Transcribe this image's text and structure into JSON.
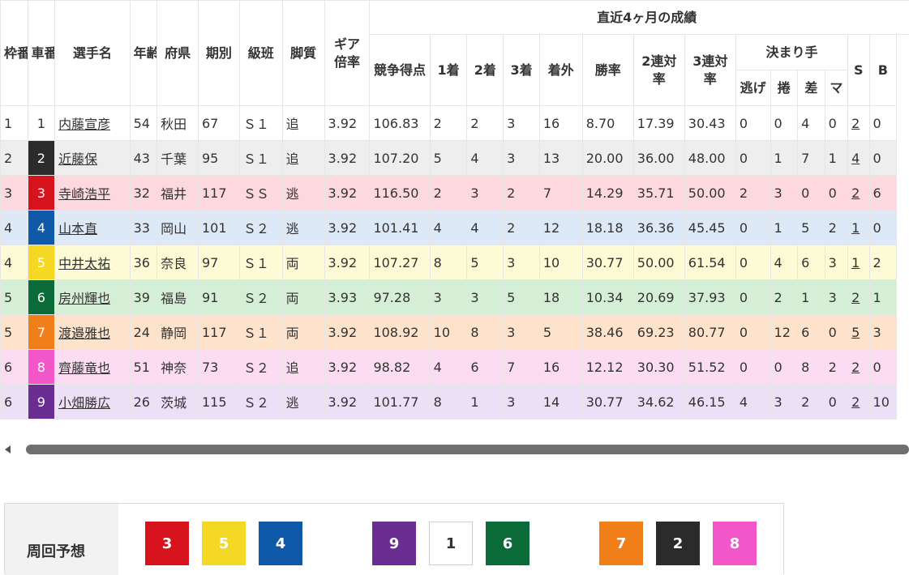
{
  "headers": {
    "waku": "枠番",
    "car": "車番",
    "name": "選手名",
    "age": "年齢",
    "pref": "府県",
    "term": "期別",
    "class": "級班",
    "leg": "脚質",
    "gear": "ギア倍率",
    "recent": "直近4ヶ月の成績",
    "score": "競争得点",
    "first": "1着",
    "second": "2着",
    "third": "3着",
    "outside": "着外",
    "win": "勝率",
    "rate2": "2連対率",
    "rate3": "3連対率",
    "kimarite": "決まり手",
    "nige": "逃げ",
    "makuri": "捲",
    "sashi": "差",
    "mark": "マ",
    "s": "S",
    "b": "B"
  },
  "rows": [
    {
      "waku": "1",
      "car": "1",
      "name": "内藤宣彦",
      "age": "54",
      "pref": "秋田",
      "term": "67",
      "class": "Ｓ１",
      "leg": "追",
      "gear": "3.92",
      "score": "106.83",
      "first": "2",
      "second": "2",
      "third": "3",
      "outside": "16",
      "win": "8.70",
      "rate2": "17.39",
      "rate3": "30.43",
      "nige": "0",
      "makuri": "0",
      "sashi": "4",
      "mark": "0",
      "s": "2",
      "b": "0",
      "bg": "#ffffff",
      "carColor": "#ffffff",
      "carText": "#333333"
    },
    {
      "waku": "2",
      "car": "2",
      "name": "近藤保",
      "age": "43",
      "pref": "千葉",
      "term": "95",
      "class": "Ｓ１",
      "leg": "追",
      "gear": "3.92",
      "score": "107.20",
      "first": "5",
      "second": "4",
      "third": "3",
      "outside": "13",
      "win": "20.00",
      "rate2": "36.00",
      "rate3": "48.00",
      "nige": "0",
      "makuri": "1",
      "sashi": "7",
      "mark": "1",
      "s": "4",
      "b": "0",
      "bg": "#eeeeee",
      "carColor": "#2b2b2b",
      "carText": "#ffffff"
    },
    {
      "waku": "3",
      "car": "3",
      "name": "寺崎浩平",
      "age": "32",
      "pref": "福井",
      "term": "117",
      "class": "ＳＳ",
      "leg": "逃",
      "gear": "3.92",
      "score": "116.50",
      "first": "2",
      "second": "3",
      "third": "2",
      "outside": "7",
      "win": "14.29",
      "rate2": "35.71",
      "rate3": "50.00",
      "nige": "2",
      "makuri": "3",
      "sashi": "0",
      "mark": "0",
      "s": "2",
      "b": "6",
      "bg": "#fdd9df",
      "carColor": "#d7141d",
      "carText": "#ffffff"
    },
    {
      "waku": "4",
      "car": "4",
      "name": "山本直",
      "age": "33",
      "pref": "岡山",
      "term": "101",
      "class": "Ｓ２",
      "leg": "逃",
      "gear": "3.92",
      "score": "101.41",
      "first": "4",
      "second": "4",
      "third": "2",
      "outside": "12",
      "win": "18.18",
      "rate2": "36.36",
      "rate3": "45.45",
      "nige": "0",
      "makuri": "1",
      "sashi": "5",
      "mark": "2",
      "s": "1",
      "b": "0",
      "bg": "#dde9f6",
      "carColor": "#0f59a8",
      "carText": "#ffffff"
    },
    {
      "waku": "4",
      "car": "5",
      "name": "中井太祐",
      "age": "36",
      "pref": "奈良",
      "term": "97",
      "class": "Ｓ１",
      "leg": "両",
      "gear": "3.92",
      "score": "107.27",
      "first": "8",
      "second": "5",
      "third": "3",
      "outside": "10",
      "win": "30.77",
      "rate2": "50.00",
      "rate3": "61.54",
      "nige": "0",
      "makuri": "4",
      "sashi": "6",
      "mark": "3",
      "s": "1",
      "b": "2",
      "bg": "#fdfbd5",
      "carColor": "#f4d823",
      "carText": "#ffffff"
    },
    {
      "waku": "5",
      "car": "6",
      "name": "房州輝也",
      "age": "39",
      "pref": "福島",
      "term": "91",
      "class": "Ｓ２",
      "leg": "両",
      "gear": "3.93",
      "score": "97.28",
      "first": "3",
      "second": "3",
      "third": "5",
      "outside": "18",
      "win": "10.34",
      "rate2": "20.69",
      "rate3": "37.93",
      "nige": "0",
      "makuri": "2",
      "sashi": "1",
      "mark": "3",
      "s": "2",
      "b": "1",
      "bg": "#d5efd6",
      "carColor": "#0a6a38",
      "carText": "#ffffff"
    },
    {
      "waku": "5",
      "car": "7",
      "name": "渡邉雅也",
      "age": "24",
      "pref": "静岡",
      "term": "117",
      "class": "Ｓ１",
      "leg": "両",
      "gear": "3.92",
      "score": "108.92",
      "first": "10",
      "second": "8",
      "third": "3",
      "outside": "5",
      "win": "38.46",
      "rate2": "69.23",
      "rate3": "80.77",
      "nige": "0",
      "makuri": "12",
      "sashi": "6",
      "mark": "0",
      "s": "5",
      "b": "3",
      "bg": "#fde3cb",
      "carColor": "#f07f1a",
      "carText": "#ffffff"
    },
    {
      "waku": "6",
      "car": "8",
      "name": "齊藤竜也",
      "age": "51",
      "pref": "神奈",
      "term": "73",
      "class": "Ｓ２",
      "leg": "追",
      "gear": "3.92",
      "score": "98.82",
      "first": "4",
      "second": "6",
      "third": "7",
      "outside": "16",
      "win": "12.12",
      "rate2": "30.30",
      "rate3": "51.52",
      "nige": "0",
      "makuri": "0",
      "sashi": "8",
      "mark": "2",
      "s": "2",
      "b": "0",
      "bg": "#fbdcf3",
      "carColor": "#f356c8",
      "carText": "#ffffff"
    },
    {
      "waku": "6",
      "car": "9",
      "name": "小畑勝広",
      "age": "26",
      "pref": "茨城",
      "term": "115",
      "class": "Ｓ２",
      "leg": "逃",
      "gear": "3.92",
      "score": "101.77",
      "first": "8",
      "second": "1",
      "third": "3",
      "outside": "14",
      "win": "30.77",
      "rate2": "34.62",
      "rate3": "46.15",
      "nige": "4",
      "makuri": "3",
      "sashi": "2",
      "mark": "0",
      "s": "2",
      "b": "10",
      "bg": "#ebe0f5",
      "carColor": "#6a2d91",
      "carText": "#ffffff"
    }
  ],
  "prediction": {
    "label": "周回予想",
    "chips": [
      {
        "num": "3",
        "color": "#d7141d",
        "text": "#ffffff"
      },
      {
        "num": "5",
        "color": "#f4d823",
        "text": "#ffffff"
      },
      {
        "num": "4",
        "color": "#0f59a8",
        "text": "#ffffff"
      },
      {
        "num": "9",
        "color": "#6a2d91",
        "text": "#ffffff"
      },
      {
        "num": "1",
        "color": "#ffffff",
        "text": "#333333"
      },
      {
        "num": "6",
        "color": "#0a6a38",
        "text": "#ffffff"
      },
      {
        "num": "7",
        "color": "#f07f1a",
        "text": "#ffffff"
      },
      {
        "num": "2",
        "color": "#2b2b2b",
        "text": "#ffffff"
      },
      {
        "num": "8",
        "color": "#f356c8",
        "text": "#ffffff"
      }
    ]
  }
}
